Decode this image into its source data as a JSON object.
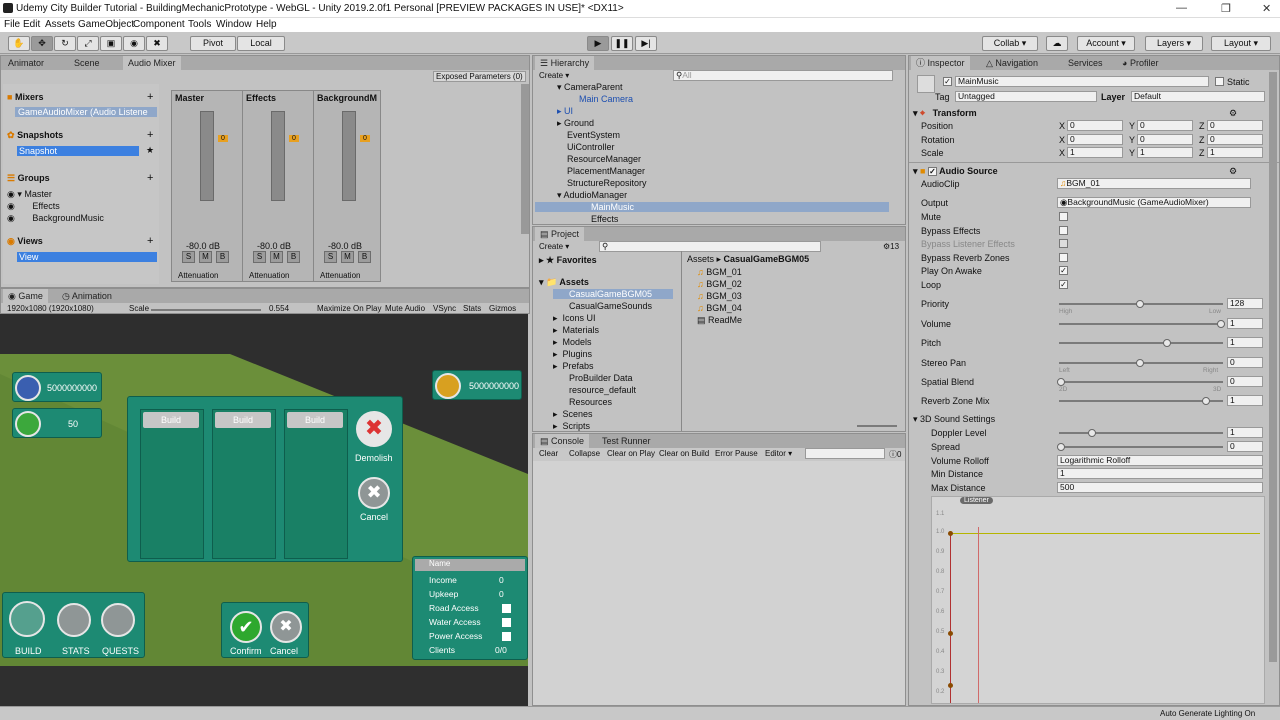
{
  "title": "Udemy City Builder Tutorial - BuildingMechanicPrototype - WebGL - Unity 2019.2.0f1 Personal [PREVIEW PACKAGES IN USE]* <DX11>",
  "menu": [
    "File",
    "Edit",
    "Assets",
    "GameObject",
    "Component",
    "Tools",
    "Window",
    "Help"
  ],
  "toolbar": {
    "pivot": "Pivot",
    "local": "Local",
    "collab": "Collab",
    "account": "Account",
    "layers": "Layers",
    "layout": "Layout"
  },
  "left_tabs": {
    "animator": "Animator",
    "scene": "Scene",
    "audio_mixer": "Audio Mixer",
    "exposed": "Exposed Parameters (0)"
  },
  "mixer": {
    "mixers_label": "Mixers",
    "mixer_item": "GameAudioMixer",
    "mixer_item_sub": "(Audio Listene",
    "snapshots_label": "Snapshots",
    "snapshot_item": "Snapshot",
    "groups_label": "Groups",
    "groups": [
      "Master",
      "Effects",
      "BackgroundMusic"
    ],
    "views_label": "Views",
    "view_item": "View",
    "strips": [
      {
        "name": "Master",
        "db": "-80.0 dB",
        "effect": "Attenuation"
      },
      {
        "name": "Effects",
        "db": "-80.0 dB",
        "effect": "Attenuation"
      },
      {
        "name": "BackgroundM",
        "db": "-80.0 dB",
        "effect": "Attenuation"
      }
    ],
    "ticks": [
      "20",
      "0",
      "-20",
      "-40",
      "-60",
      "-80"
    ]
  },
  "game_tabs": {
    "game": "Game",
    "animation": "Animation"
  },
  "game_bar": {
    "resolution": "1920x1080 (1920x1080)",
    "scale": "Scale",
    "scale_val": "0.554",
    "max": "Maximize On Play",
    "mute": "Mute Audio",
    "vsync": "VSync",
    "stats": "Stats",
    "gizmos": "Gizmos"
  },
  "game": {
    "population": "5000000000",
    "money": "5000000000",
    "likes": "50",
    "build": "Build",
    "demolish": "Demolish",
    "cancel": "Cancel",
    "confirm": "Confirm",
    "nav": [
      "BUILD",
      "STATS",
      "QUESTS"
    ],
    "info_title": "Name",
    "info": [
      {
        "k": "Income",
        "v": "0"
      },
      {
        "k": "Upkeep",
        "v": "0"
      },
      {
        "k": "Road Access",
        "v": ""
      },
      {
        "k": "Water Access",
        "v": ""
      },
      {
        "k": "Power Access",
        "v": ""
      },
      {
        "k": "Clients",
        "v": "0/0"
      }
    ]
  },
  "hierarchy": {
    "tab": "Hierarchy",
    "create": "Create",
    "search": "All",
    "items": [
      "CameraParent",
      "Main Camera",
      "UI",
      "Ground",
      "EventSystem",
      "UiController",
      "ResourceManager",
      "PlacementManager",
      "StructureRepository",
      "AdudioManager",
      "MainMusic",
      "Effects"
    ]
  },
  "project": {
    "tab": "Project",
    "create": "Create",
    "count": "13",
    "favorites": "Favorites",
    "assets": "Assets",
    "folders": [
      "CasualGameBGM05",
      "CasualGameSounds",
      "Icons UI",
      "Materials",
      "Models",
      "Plugins",
      "Prefabs",
      "ProBuilder Data",
      "resource_default",
      "Resources",
      "Scenes",
      "Scripts"
    ],
    "breadcrumb": [
      "Assets",
      "CasualGameBGM05"
    ],
    "files": [
      "BGM_01",
      "BGM_02",
      "BGM_03",
      "BGM_04",
      "ReadMe"
    ]
  },
  "console": {
    "tab": "Console",
    "tab2": "Test Runner",
    "buttons": [
      "Clear",
      "Collapse",
      "Clear on Play",
      "Clear on Build",
      "Error Pause",
      "Editor"
    ],
    "count": "0"
  },
  "inspector": {
    "tabs": [
      "Inspector",
      "Navigation",
      "Services",
      "Profiler"
    ],
    "object_name": "MainMusic",
    "static": "Static",
    "tag_label": "Tag",
    "tag": "Untagged",
    "layer_label": "Layer",
    "layer": "Default",
    "transform": "Transform",
    "position": "Position",
    "rotation": "Rotation",
    "scale": "Scale",
    "pos": [
      "0",
      "0",
      "0"
    ],
    "rot": [
      "0",
      "0",
      "0"
    ],
    "scl": [
      "1",
      "1",
      "1"
    ],
    "audio_source": "Audio Source",
    "audioclip_label": "AudioClip",
    "audioclip": "BGM_01",
    "output_label": "Output",
    "output": "BackgroundMusic (GameAudioMixer)",
    "mute": "Mute",
    "bypass": "Bypass Effects",
    "bypass_listener": "Bypass Listener Effects",
    "bypass_reverb": "Bypass Reverb Zones",
    "play_on_awake": "Play On Awake",
    "loop": "Loop",
    "priority": "Priority",
    "priority_val": "128",
    "high": "High",
    "low": "Low",
    "volume": "Volume",
    "volume_val": "1",
    "pitch": "Pitch",
    "pitch_val": "1",
    "stereo": "Stereo Pan",
    "stereo_val": "0",
    "left": "Left",
    "right": "Right",
    "spatial": "Spatial Blend",
    "spatial_val": "0",
    "2d": "2D",
    "3d": "3D",
    "reverb": "Reverb Zone Mix",
    "reverb_val": "1",
    "sound3d": "3D Sound Settings",
    "doppler": "Doppler Level",
    "doppler_val": "1",
    "spread": "Spread",
    "spread_val": "0",
    "rolloff": "Volume Rolloff",
    "rolloff_val": "Logarithmic Rolloff",
    "min_dist": "Min Distance",
    "min_val": "1",
    "max_dist": "Max Distance",
    "max_val": "500",
    "listener": "Listener",
    "graph_ticks": [
      "1.1",
      "1.0",
      "0.9",
      "0.8",
      "0.7",
      "0.6",
      "0.5",
      "0.4",
      "0.3",
      "0.2"
    ]
  },
  "status": "Auto Generate Lighting On",
  "colors": {
    "accent": "#3c80e0",
    "teal": "#1d8a73",
    "toolbar": "#c8c8c8"
  }
}
